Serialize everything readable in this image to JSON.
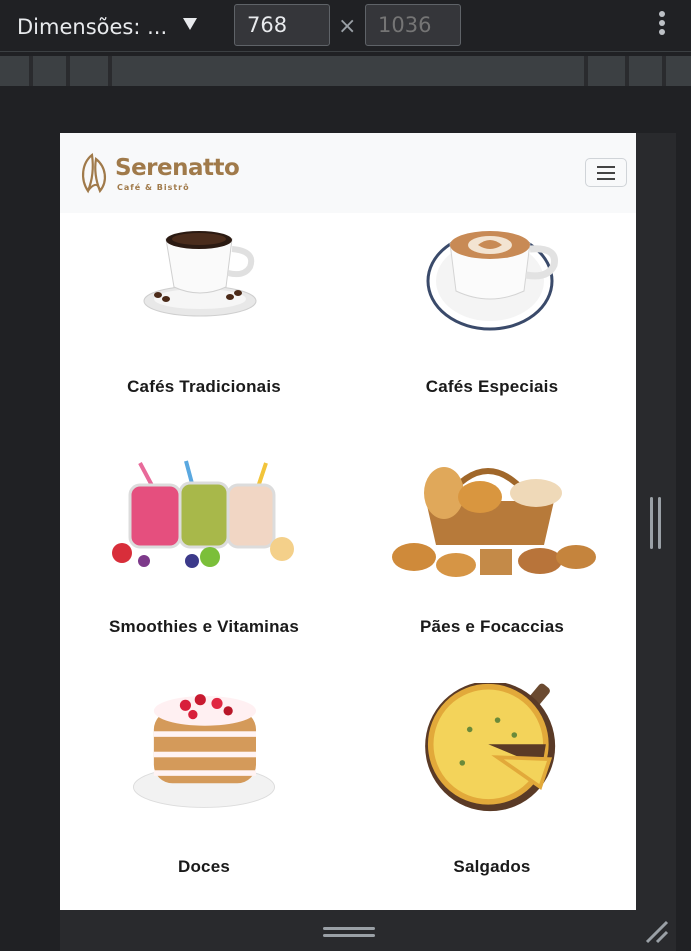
{
  "devtools": {
    "dimensions_label": "Dimensões: ...",
    "width_value": "768",
    "height_placeholder": "1036",
    "times_symbol": "×",
    "menu_icon": "kebab-menu-icon"
  },
  "site": {
    "brand_name": "Serenatto",
    "brand_tagline": "Café & Bistrô",
    "logo_icon": "leaf-logo-icon",
    "menu_icon": "hamburger-icon",
    "accent_color": "#a07a4a"
  },
  "categories": [
    {
      "label": "Cafés Tradicionais",
      "image": "espresso-cup-image"
    },
    {
      "label": "Cafés Especiais",
      "image": "latte-art-cup-image"
    },
    {
      "label": "Smoothies e Vitaminas",
      "image": "smoothie-jars-image"
    },
    {
      "label": "Pães e Focaccias",
      "image": "bread-basket-image"
    },
    {
      "label": "Doces",
      "image": "layer-cake-image"
    },
    {
      "label": "Salgados",
      "image": "quiche-image"
    }
  ]
}
